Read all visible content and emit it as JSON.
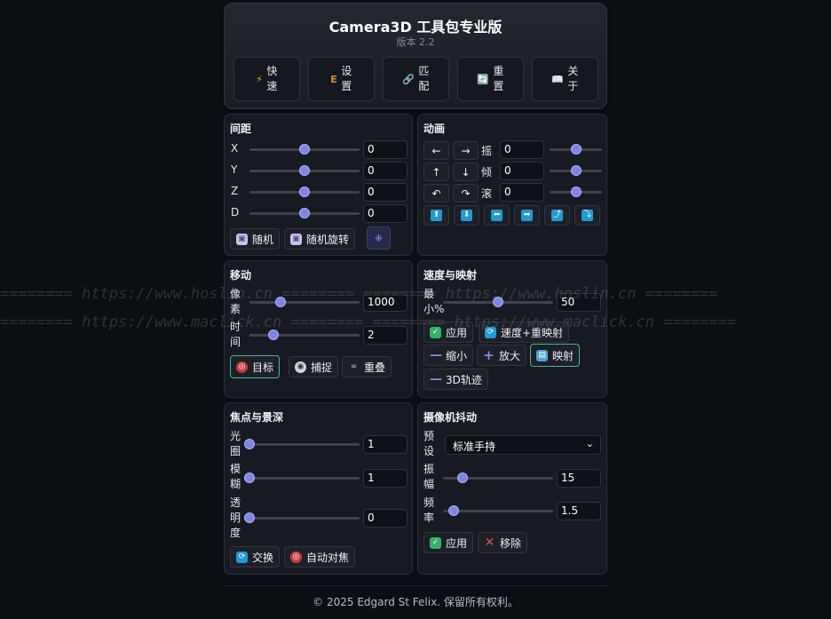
{
  "header": {
    "title": "Camera3D 工具包专业版",
    "version": "版本 2.2",
    "buttons": [
      {
        "icon": "⚡",
        "label": "快速"
      },
      {
        "icon": "E",
        "label": "设置"
      },
      {
        "icon": "🔗",
        "label": "匹配"
      },
      {
        "icon": "🔄",
        "label": "重置"
      },
      {
        "icon": "📖",
        "label": "关于"
      }
    ]
  },
  "spacing": {
    "title": "间距",
    "rows": [
      {
        "label": "X",
        "value": "0",
        "slider": 0.5
      },
      {
        "label": "Y",
        "value": "0",
        "slider": 0.5
      },
      {
        "label": "Z",
        "value": "0",
        "slider": 0.5
      },
      {
        "label": "D",
        "value": "0",
        "slider": 0.5
      }
    ],
    "random_label": "随机",
    "random_rotate_label": "随机旋转"
  },
  "animation": {
    "title": "动画",
    "rows": [
      {
        "b1": "←",
        "b2": "→",
        "label": "摇",
        "value": "0",
        "slider": 0.5
      },
      {
        "b1": "↑",
        "b2": "↓",
        "label": "倾",
        "value": "0",
        "slider": 0.5
      },
      {
        "b1": "↶",
        "b2": "↷",
        "label": "滚",
        "value": "0",
        "slider": 0.5
      }
    ],
    "icon_buttons": [
      "⬆",
      "⬇",
      "⬅",
      "➡",
      "⤴",
      "⤵"
    ]
  },
  "move": {
    "title": "移动",
    "pixels_label": "像素",
    "pixels_value": "1000",
    "pixels_slider": 0.28,
    "time_label": "时间",
    "time_value": "2",
    "time_slider": 0.22,
    "target_label": "目标",
    "capture_label": "捕捉",
    "overlap_label": "重叠"
  },
  "speed": {
    "title": "速度与映射",
    "min_label": "最小%",
    "min_value": "50",
    "min_slider": 0.5,
    "apply_label": "应用",
    "speed_remap_label": "速度+重映射",
    "shrink_label": "缩小",
    "enlarge_label": "放大",
    "map_label": "映射",
    "track_label": "3D轨迹"
  },
  "focus": {
    "title": "焦点与景深",
    "rows": [
      {
        "label": "光圈",
        "value": "1",
        "slider": 0.0
      },
      {
        "label": "模糊",
        "value": "1",
        "slider": 0.0
      },
      {
        "label": "透明度",
        "value": "0",
        "slider": 0.0
      }
    ],
    "swap_label": "交换",
    "autofocus_label": "自动对焦"
  },
  "shake": {
    "title": "摄像机抖动",
    "preset_label": "预设",
    "preset_value": "标准手持",
    "amp_label": "振幅",
    "amp_value": "15",
    "amp_slider": 0.18,
    "freq_label": "频率",
    "freq_value": "1.5",
    "freq_slider": 0.1,
    "apply_label": "应用",
    "remove_label": "移除"
  },
  "watermark": {
    "line1": "======== https://www.hoslin.cn ======== ======== https://www.hoslin.cn ========",
    "line2": "======== https://www.maclick.cn ======== ======== https://www.maclick.cn ========"
  },
  "footer": "© 2025 Edgard St Felix. 保留所有权利。",
  "colors": {
    "accent": "#7b86e8",
    "highlight": "#3fb6a0",
    "background": "#0b0e13"
  }
}
